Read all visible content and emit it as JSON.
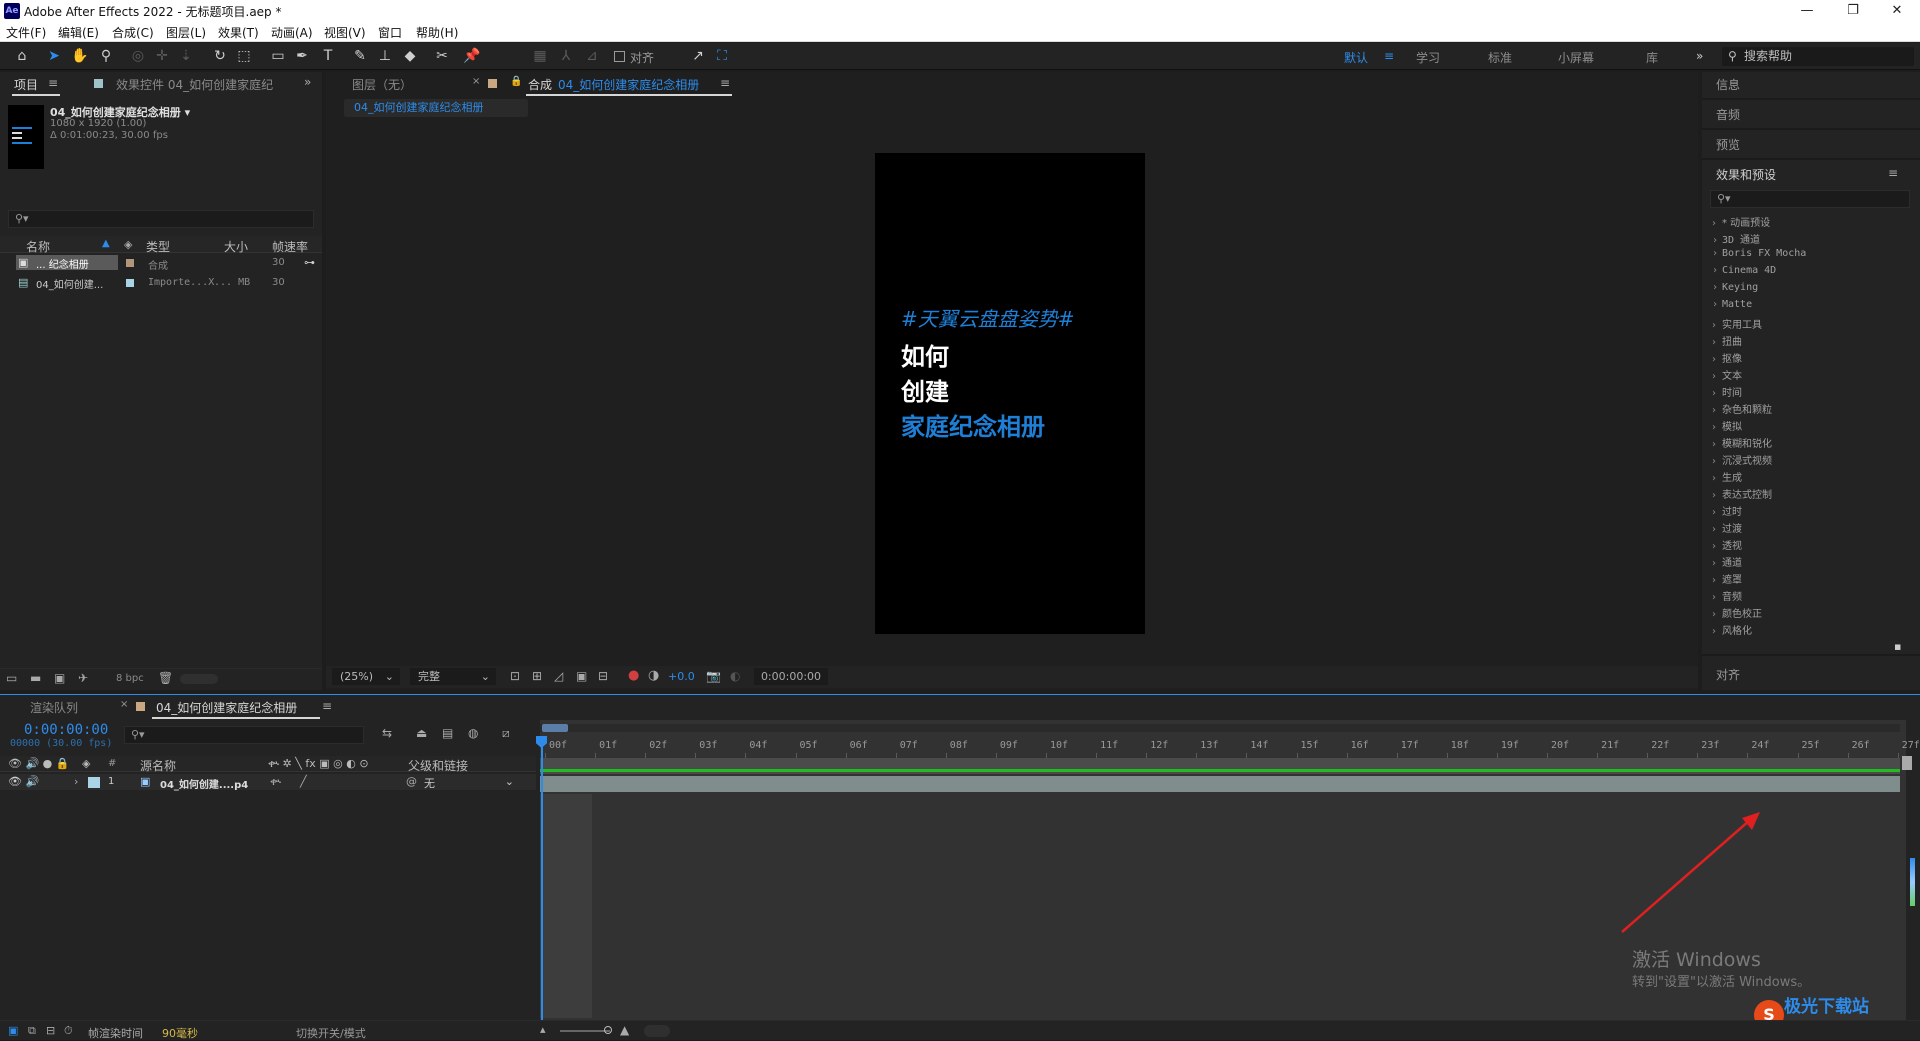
{
  "window": {
    "app_icon": "Ae",
    "title": "Adobe After Effects 2022 - 无标题项目.aep *",
    "minimize": "—",
    "maximize": "❐",
    "close": "✕"
  },
  "menu": [
    "文件(F)",
    "编辑(E)",
    "合成(C)",
    "图层(L)",
    "效果(T)",
    "动画(A)",
    "视图(V)",
    "窗口",
    "帮助(H)"
  ],
  "toolbar": {
    "align_label": "对齐",
    "workspaces": [
      "默认",
      "学习",
      "标准",
      "小屏幕",
      "库"
    ],
    "active_workspace": "默认",
    "more": "»",
    "search_help": "搜索帮助"
  },
  "project_panel": {
    "tab_project": "项目",
    "tab_effects": "效果控件 04_如何创建家庭纪",
    "expand": "»",
    "comp_name": "04_如何创建家庭纪念相册 ▾",
    "comp_size": "1080 x 1920 (1.00)",
    "comp_duration": "Δ 0:01:00:23, 30.00 fps",
    "search_placeholder": "",
    "columns": {
      "name": "名称",
      "type": "类型",
      "size": "大小",
      "fps": "帧速率"
    },
    "rows": [
      {
        "name": "... 纪念相册",
        "type": "合成",
        "size": "",
        "fps": "30",
        "color": "#b2967b",
        "selected": true
      },
      {
        "name": "04_如何创建...",
        "type": "Importe...X",
        "size": "... MB",
        "fps": "30",
        "color": "#a8d4e6",
        "selected": false
      }
    ],
    "bpc": "8 bpc"
  },
  "viewer": {
    "tab_layer": "图层（无）",
    "tab_comp_prefix": "合成",
    "tab_comp_name": "04_如何创建家庭纪念相册",
    "breadcrumb": "04_如何创建家庭纪念相册",
    "frame_text": {
      "hashtag": "#天翼云盘盘姿势#",
      "line1": "如何",
      "line2": "创建",
      "line3": "家庭纪念相册"
    },
    "zoom": "(25%)",
    "quality": "完整",
    "exposure": "+0.0",
    "timecode": "0:00:00:00"
  },
  "right_panel": {
    "info": "信息",
    "audio": "音频",
    "preview": "预览",
    "effects_title": "效果和预设",
    "effects_items": [
      "* 动画预设",
      "3D 通道",
      "Boris FX Mocha",
      "Cinema 4D",
      "Keying",
      "Matte",
      "实用工具",
      "扭曲",
      "抠像",
      "文本",
      "时间",
      "杂色和颗粒",
      "模拟",
      "模糊和锐化",
      "沉浸式视频",
      "生成",
      "表达式控制",
      "过时",
      "过渡",
      "透视",
      "通道",
      "遮罩",
      "音频",
      "颜色校正",
      "风格化"
    ],
    "align": "对齐"
  },
  "timeline": {
    "tab_render": "渲染队列",
    "tab_comp": "04_如何创建家庭纪念相册",
    "timecode": "0:00:00:00",
    "timecode_sub": "00000 (30.00 fps)",
    "col_source": "源名称",
    "col_parent": "父级和链接",
    "layer_num": "1",
    "layer_name": "04_如何创建....p4",
    "layer_parent": "无",
    "ruler": [
      "00f",
      "01f",
      "02f",
      "03f",
      "04f",
      "05f",
      "06f",
      "07f",
      "08f",
      "09f",
      "10f",
      "11f",
      "12f",
      "13f",
      "14f",
      "15f",
      "16f",
      "17f",
      "18f",
      "19f",
      "20f",
      "21f",
      "22f",
      "23f",
      "24f",
      "25f",
      "26f",
      "27f"
    ],
    "footer_render_label": "帧渲染时间",
    "footer_render_value": "90毫秒",
    "footer_toggle": "切换开关/模式"
  },
  "overlay": {
    "activate_title": "激活 Windows",
    "activate_sub": "转到\"设置\"以激活 Windows。",
    "watermark": "极光下载站"
  },
  "colors": {
    "accent": "#2d8ceb",
    "panel": "#232323",
    "bg": "#1d1d1d",
    "hashtag": "#1e7fd6",
    "arrow": "#e02020"
  }
}
